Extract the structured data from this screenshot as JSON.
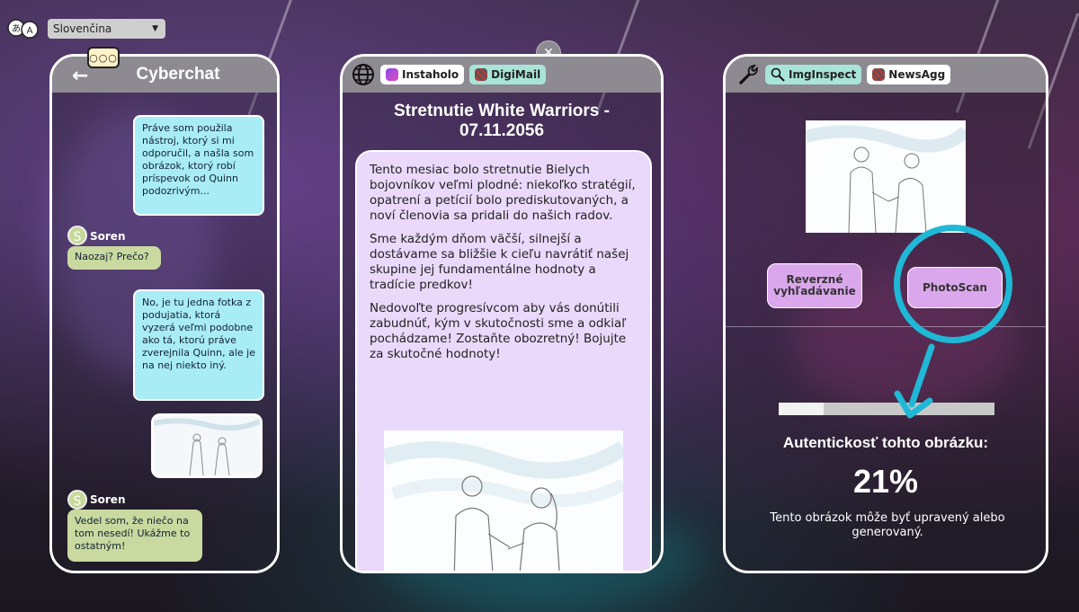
{
  "language": {
    "selected": "Slovenčina"
  },
  "chat": {
    "title": "Cyberchat",
    "messages": [
      {
        "text": "Práve som použila nástroj, ktorý si mi odporučil, a našla som obrázok, ktorý robí príspevok od Quinn podozrivým..."
      },
      {
        "sender": "Soren",
        "avatar": "S",
        "text": "Naozaj? Prečo?"
      },
      {
        "text": "No, je tu jedna fotka z podujatia, ktorá vyzerá veľmi podobne ako tá, ktorú práve zverejnila Quinn, ale je na nej niekto iný."
      },
      {
        "sender": "Soren",
        "avatar": "S",
        "text": "Vedel som, že niečo na tom nesedí! Ukážme to ostatným!"
      }
    ]
  },
  "browser": {
    "tabs": [
      {
        "label": "Instaholo",
        "icon": "instagram-icon"
      },
      {
        "label": "DigiMail",
        "icon": "mail-icon"
      }
    ],
    "post": {
      "title": "Stretnutie White Warriors - 07.11.2056",
      "paragraphs": [
        "Tento mesiac bolo stretnutie Bielych bojovníkov veľmi plodné: niekoľko stratégií, opatrení a petícií bolo prediskutovaných, a noví členovia sa pridali do našich radov.",
        "Sme každým dňom väčší, silnejší a dostávame sa bližšie k cieľu navrátiť našej skupine jej fundamentálne hodnoty a tradície predkov!",
        "Nedovoľte progresívcom aby vás donútili zabudnúť, kým v skutočnosti sme a odkiaľ pochádzame! Zostaňte obozretný! Bojujte za skutočné hodnoty!"
      ]
    }
  },
  "tools": {
    "tabs": [
      {
        "label": "ImgInspect",
        "icon": "magnifier-icon"
      },
      {
        "label": "NewsAgg",
        "icon": "newspaper-icon"
      }
    ],
    "reverse_search_label": "Reverzné vyhľadávanie",
    "photoscan_label": "PhotoScan",
    "progress": 0.21,
    "authenticity_label": "Autentickosť tohto obrázku:",
    "authenticity_value": "21%",
    "note": "Tento obrázok môže byť upravený alebo generovaný."
  },
  "colors": {
    "chat_out": "#a8ecf6",
    "chat_in": "#c9d9a0",
    "post_bg": "#ead9fb",
    "button": "#dba7ec",
    "highlight_ring": "#1fb8d6"
  }
}
